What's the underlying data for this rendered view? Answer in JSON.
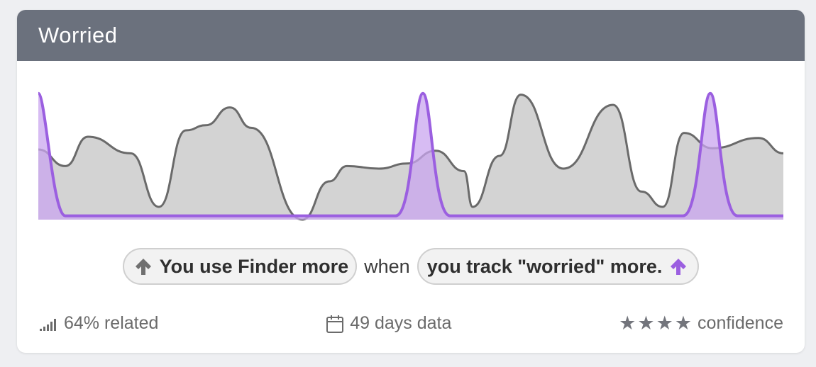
{
  "card": {
    "title": "Worried"
  },
  "chart_data": {
    "type": "area",
    "days": 49,
    "x_points": 50,
    "ylim": [
      0,
      1
    ],
    "series": [
      {
        "color": "#6a6a6a",
        "fill": "#d3d3d3",
        "values": [
          0.55,
          0.42,
          0.65,
          0.52,
          0.1,
          0.7,
          0.74,
          0.88,
          0.72,
          0.0,
          0.3,
          0.42,
          0.4,
          0.44,
          0.54,
          0.38,
          0.1,
          0.5,
          0.98,
          0.4,
          0.9,
          0.22,
          0.1,
          0.68,
          0.56,
          0.64,
          0.52
        ]
      },
      {
        "color": "#9b5fe0",
        "fill": "#c9a6ef",
        "values": [
          0.99,
          0.05,
          0.03,
          0.99,
          0.04,
          0.99,
          0.04
        ]
      }
    ]
  },
  "statement": {
    "left_label": "You use Finder more",
    "conjunction": "when",
    "right_label": "you track \"worried\" more.",
    "left_arrow_color": "#707070",
    "right_arrow_color": "#9b5fe0"
  },
  "footer": {
    "related": "64% related",
    "days": "49 days data",
    "confidence": "confidence",
    "stars": 4
  }
}
